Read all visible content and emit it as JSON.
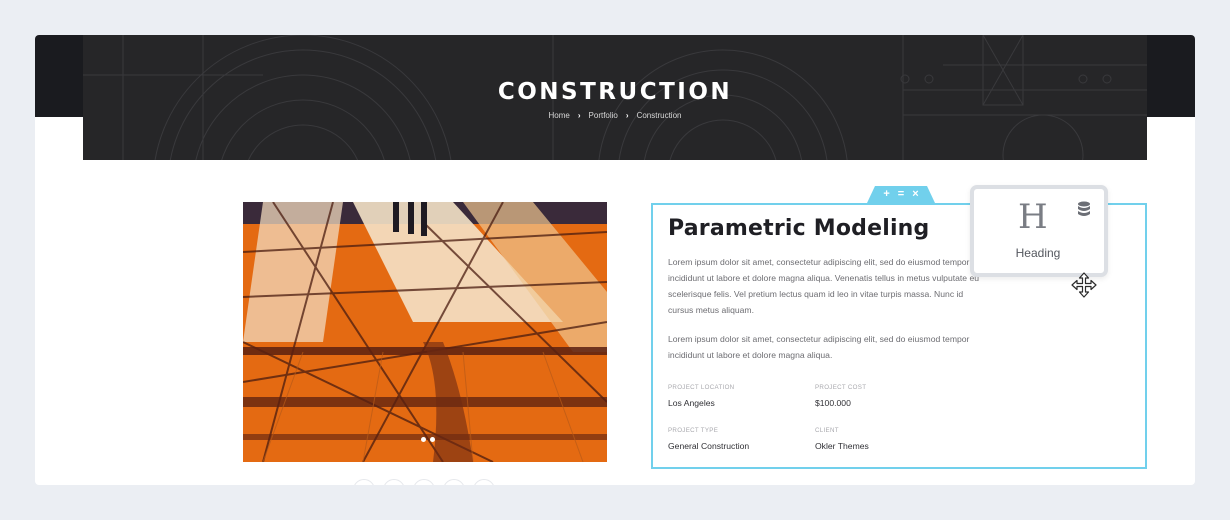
{
  "banner": {
    "title": "CONSTRUCTION",
    "breadcrumb": [
      "Home",
      "Portfolio",
      "Construction"
    ]
  },
  "section": {
    "title": "Parametric Modeling",
    "paragraphs": [
      "Lorem ipsum dolor sit amet, consectetur adipiscing elit, sed do eiusmod tempor incididunt ut labore et dolore magna aliqua. Venenatis tellus in metus vulputate eu scelerisque felis. Vel pretium lectus quam id leo in vitae turpis massa. Nunc id cursus metus aliquam.",
      "Lorem ipsum dolor sit amet, consectetur adipiscing elit, sed do eiusmod tempor incididunt ut labore et dolore magna aliqua."
    ],
    "details": [
      {
        "label": "PROJECT LOCATION",
        "value": "Los Angeles"
      },
      {
        "label": "PROJECT COST",
        "value": "$100.000"
      },
      {
        "label": "PROJECT TYPE",
        "value": "General Construction"
      },
      {
        "label": "CLIENT",
        "value": "Okler Themes"
      }
    ],
    "handle": {
      "add": "+",
      "move": "=",
      "remove": "×"
    }
  },
  "widget": {
    "icon": "heading-icon",
    "glyph": "H",
    "label": "Heading"
  },
  "colors": {
    "accent": "#71d0ec",
    "banner": "#262628",
    "frame_top": "#1a1b1f",
    "photo_orange": "#e06a10"
  }
}
